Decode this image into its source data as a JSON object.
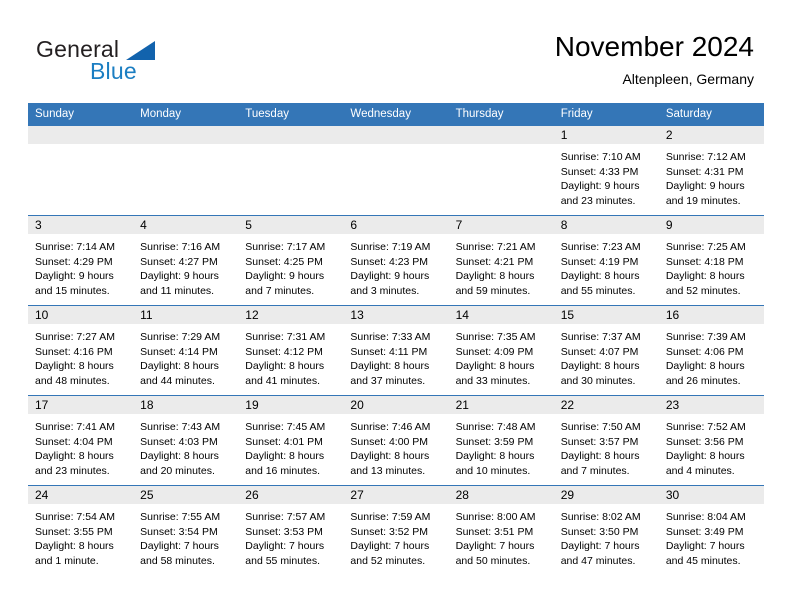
{
  "brand": {
    "name_part1": "General",
    "name_part2": "Blue",
    "triangle_color": "#1263ad",
    "blue_color": "#1b7ec2"
  },
  "header": {
    "title": "November 2024",
    "subtitle": "Altenpleen, Germany",
    "accent_color": "#3476b7",
    "daynum_band_color": "#ebebeb"
  },
  "weekday_headers": [
    "Sunday",
    "Monday",
    "Tuesday",
    "Wednesday",
    "Thursday",
    "Friday",
    "Saturday"
  ],
  "weeks": [
    [
      {
        "day": "",
        "sunrise": "",
        "sunset": "",
        "daylight_line1": "",
        "daylight_line2": ""
      },
      {
        "day": "",
        "sunrise": "",
        "sunset": "",
        "daylight_line1": "",
        "daylight_line2": ""
      },
      {
        "day": "",
        "sunrise": "",
        "sunset": "",
        "daylight_line1": "",
        "daylight_line2": ""
      },
      {
        "day": "",
        "sunrise": "",
        "sunset": "",
        "daylight_line1": "",
        "daylight_line2": ""
      },
      {
        "day": "",
        "sunrise": "",
        "sunset": "",
        "daylight_line1": "",
        "daylight_line2": ""
      },
      {
        "day": "1",
        "sunrise": "Sunrise: 7:10 AM",
        "sunset": "Sunset: 4:33 PM",
        "daylight_line1": "Daylight: 9 hours",
        "daylight_line2": "and 23 minutes."
      },
      {
        "day": "2",
        "sunrise": "Sunrise: 7:12 AM",
        "sunset": "Sunset: 4:31 PM",
        "daylight_line1": "Daylight: 9 hours",
        "daylight_line2": "and 19 minutes."
      }
    ],
    [
      {
        "day": "3",
        "sunrise": "Sunrise: 7:14 AM",
        "sunset": "Sunset: 4:29 PM",
        "daylight_line1": "Daylight: 9 hours",
        "daylight_line2": "and 15 minutes."
      },
      {
        "day": "4",
        "sunrise": "Sunrise: 7:16 AM",
        "sunset": "Sunset: 4:27 PM",
        "daylight_line1": "Daylight: 9 hours",
        "daylight_line2": "and 11 minutes."
      },
      {
        "day": "5",
        "sunrise": "Sunrise: 7:17 AM",
        "sunset": "Sunset: 4:25 PM",
        "daylight_line1": "Daylight: 9 hours",
        "daylight_line2": "and 7 minutes."
      },
      {
        "day": "6",
        "sunrise": "Sunrise: 7:19 AM",
        "sunset": "Sunset: 4:23 PM",
        "daylight_line1": "Daylight: 9 hours",
        "daylight_line2": "and 3 minutes."
      },
      {
        "day": "7",
        "sunrise": "Sunrise: 7:21 AM",
        "sunset": "Sunset: 4:21 PM",
        "daylight_line1": "Daylight: 8 hours",
        "daylight_line2": "and 59 minutes."
      },
      {
        "day": "8",
        "sunrise": "Sunrise: 7:23 AM",
        "sunset": "Sunset: 4:19 PM",
        "daylight_line1": "Daylight: 8 hours",
        "daylight_line2": "and 55 minutes."
      },
      {
        "day": "9",
        "sunrise": "Sunrise: 7:25 AM",
        "sunset": "Sunset: 4:18 PM",
        "daylight_line1": "Daylight: 8 hours",
        "daylight_line2": "and 52 minutes."
      }
    ],
    [
      {
        "day": "10",
        "sunrise": "Sunrise: 7:27 AM",
        "sunset": "Sunset: 4:16 PM",
        "daylight_line1": "Daylight: 8 hours",
        "daylight_line2": "and 48 minutes."
      },
      {
        "day": "11",
        "sunrise": "Sunrise: 7:29 AM",
        "sunset": "Sunset: 4:14 PM",
        "daylight_line1": "Daylight: 8 hours",
        "daylight_line2": "and 44 minutes."
      },
      {
        "day": "12",
        "sunrise": "Sunrise: 7:31 AM",
        "sunset": "Sunset: 4:12 PM",
        "daylight_line1": "Daylight: 8 hours",
        "daylight_line2": "and 41 minutes."
      },
      {
        "day": "13",
        "sunrise": "Sunrise: 7:33 AM",
        "sunset": "Sunset: 4:11 PM",
        "daylight_line1": "Daylight: 8 hours",
        "daylight_line2": "and 37 minutes."
      },
      {
        "day": "14",
        "sunrise": "Sunrise: 7:35 AM",
        "sunset": "Sunset: 4:09 PM",
        "daylight_line1": "Daylight: 8 hours",
        "daylight_line2": "and 33 minutes."
      },
      {
        "day": "15",
        "sunrise": "Sunrise: 7:37 AM",
        "sunset": "Sunset: 4:07 PM",
        "daylight_line1": "Daylight: 8 hours",
        "daylight_line2": "and 30 minutes."
      },
      {
        "day": "16",
        "sunrise": "Sunrise: 7:39 AM",
        "sunset": "Sunset: 4:06 PM",
        "daylight_line1": "Daylight: 8 hours",
        "daylight_line2": "and 26 minutes."
      }
    ],
    [
      {
        "day": "17",
        "sunrise": "Sunrise: 7:41 AM",
        "sunset": "Sunset: 4:04 PM",
        "daylight_line1": "Daylight: 8 hours",
        "daylight_line2": "and 23 minutes."
      },
      {
        "day": "18",
        "sunrise": "Sunrise: 7:43 AM",
        "sunset": "Sunset: 4:03 PM",
        "daylight_line1": "Daylight: 8 hours",
        "daylight_line2": "and 20 minutes."
      },
      {
        "day": "19",
        "sunrise": "Sunrise: 7:45 AM",
        "sunset": "Sunset: 4:01 PM",
        "daylight_line1": "Daylight: 8 hours",
        "daylight_line2": "and 16 minutes."
      },
      {
        "day": "20",
        "sunrise": "Sunrise: 7:46 AM",
        "sunset": "Sunset: 4:00 PM",
        "daylight_line1": "Daylight: 8 hours",
        "daylight_line2": "and 13 minutes."
      },
      {
        "day": "21",
        "sunrise": "Sunrise: 7:48 AM",
        "sunset": "Sunset: 3:59 PM",
        "daylight_line1": "Daylight: 8 hours",
        "daylight_line2": "and 10 minutes."
      },
      {
        "day": "22",
        "sunrise": "Sunrise: 7:50 AM",
        "sunset": "Sunset: 3:57 PM",
        "daylight_line1": "Daylight: 8 hours",
        "daylight_line2": "and 7 minutes."
      },
      {
        "day": "23",
        "sunrise": "Sunrise: 7:52 AM",
        "sunset": "Sunset: 3:56 PM",
        "daylight_line1": "Daylight: 8 hours",
        "daylight_line2": "and 4 minutes."
      }
    ],
    [
      {
        "day": "24",
        "sunrise": "Sunrise: 7:54 AM",
        "sunset": "Sunset: 3:55 PM",
        "daylight_line1": "Daylight: 8 hours",
        "daylight_line2": "and 1 minute."
      },
      {
        "day": "25",
        "sunrise": "Sunrise: 7:55 AM",
        "sunset": "Sunset: 3:54 PM",
        "daylight_line1": "Daylight: 7 hours",
        "daylight_line2": "and 58 minutes."
      },
      {
        "day": "26",
        "sunrise": "Sunrise: 7:57 AM",
        "sunset": "Sunset: 3:53 PM",
        "daylight_line1": "Daylight: 7 hours",
        "daylight_line2": "and 55 minutes."
      },
      {
        "day": "27",
        "sunrise": "Sunrise: 7:59 AM",
        "sunset": "Sunset: 3:52 PM",
        "daylight_line1": "Daylight: 7 hours",
        "daylight_line2": "and 52 minutes."
      },
      {
        "day": "28",
        "sunrise": "Sunrise: 8:00 AM",
        "sunset": "Sunset: 3:51 PM",
        "daylight_line1": "Daylight: 7 hours",
        "daylight_line2": "and 50 minutes."
      },
      {
        "day": "29",
        "sunrise": "Sunrise: 8:02 AM",
        "sunset": "Sunset: 3:50 PM",
        "daylight_line1": "Daylight: 7 hours",
        "daylight_line2": "and 47 minutes."
      },
      {
        "day": "30",
        "sunrise": "Sunrise: 8:04 AM",
        "sunset": "Sunset: 3:49 PM",
        "daylight_line1": "Daylight: 7 hours",
        "daylight_line2": "and 45 minutes."
      }
    ]
  ]
}
